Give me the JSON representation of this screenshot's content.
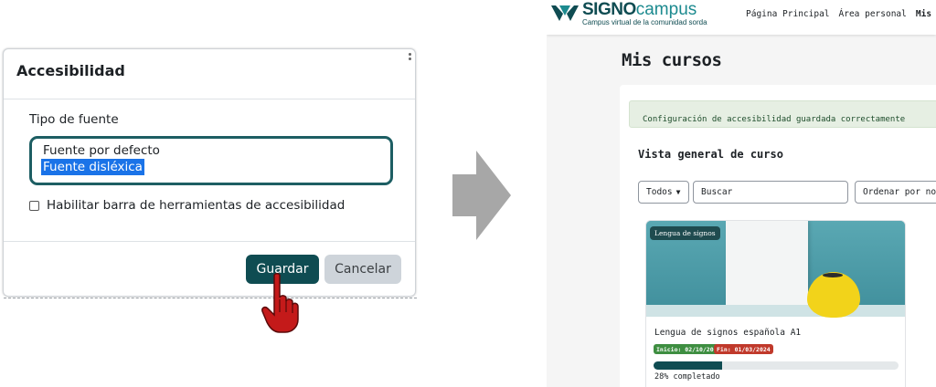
{
  "dialog": {
    "title": "Accesibilidad",
    "font_label": "Tipo de fuente",
    "font_options": [
      "Fuente por defecto",
      "Fuente disléxica"
    ],
    "selected_option": "Fuente disléxica",
    "toolbar_checkbox_label": "Habilitar barra de herramientas de accesibilidad",
    "toolbar_checkbox_checked": false,
    "save_label": "Guardar",
    "cancel_label": "Cancelar"
  },
  "site": {
    "logo_signo": "SIGNO",
    "logo_campus": "campus",
    "logo_tagline": "Campus virtual de la comunidad sorda",
    "nav": [
      "Página Principal",
      "Área personal",
      "Mis cursos"
    ],
    "active_nav": "Mis cursos",
    "page_title": "Mis cursos",
    "alert": "Configuración de accesibilidad guardada correctamente",
    "section_title": "Vista general de curso",
    "filter_all": "Todos",
    "search_placeholder": "Buscar",
    "sort_label": "Ordenar por nombre",
    "course": {
      "category": "Lengua de signos",
      "name": "Lengua de signos española A1",
      "start": "Inicio: 02/10/2023",
      "end": "Fin: 01/03/2024",
      "progress": 28,
      "progress_text": "28% completado"
    }
  },
  "colors": {
    "primary": "#0f4c52",
    "select_border": "#1d5e63",
    "highlight": "#1a73e8",
    "alert_bg": "#e6efe3",
    "cursor": "#c41a1a"
  },
  "icons": [
    "kebab-icon",
    "hand-pointer-icon",
    "right-arrow-icon",
    "signo-logo-icon",
    "caret-down-icon"
  ]
}
